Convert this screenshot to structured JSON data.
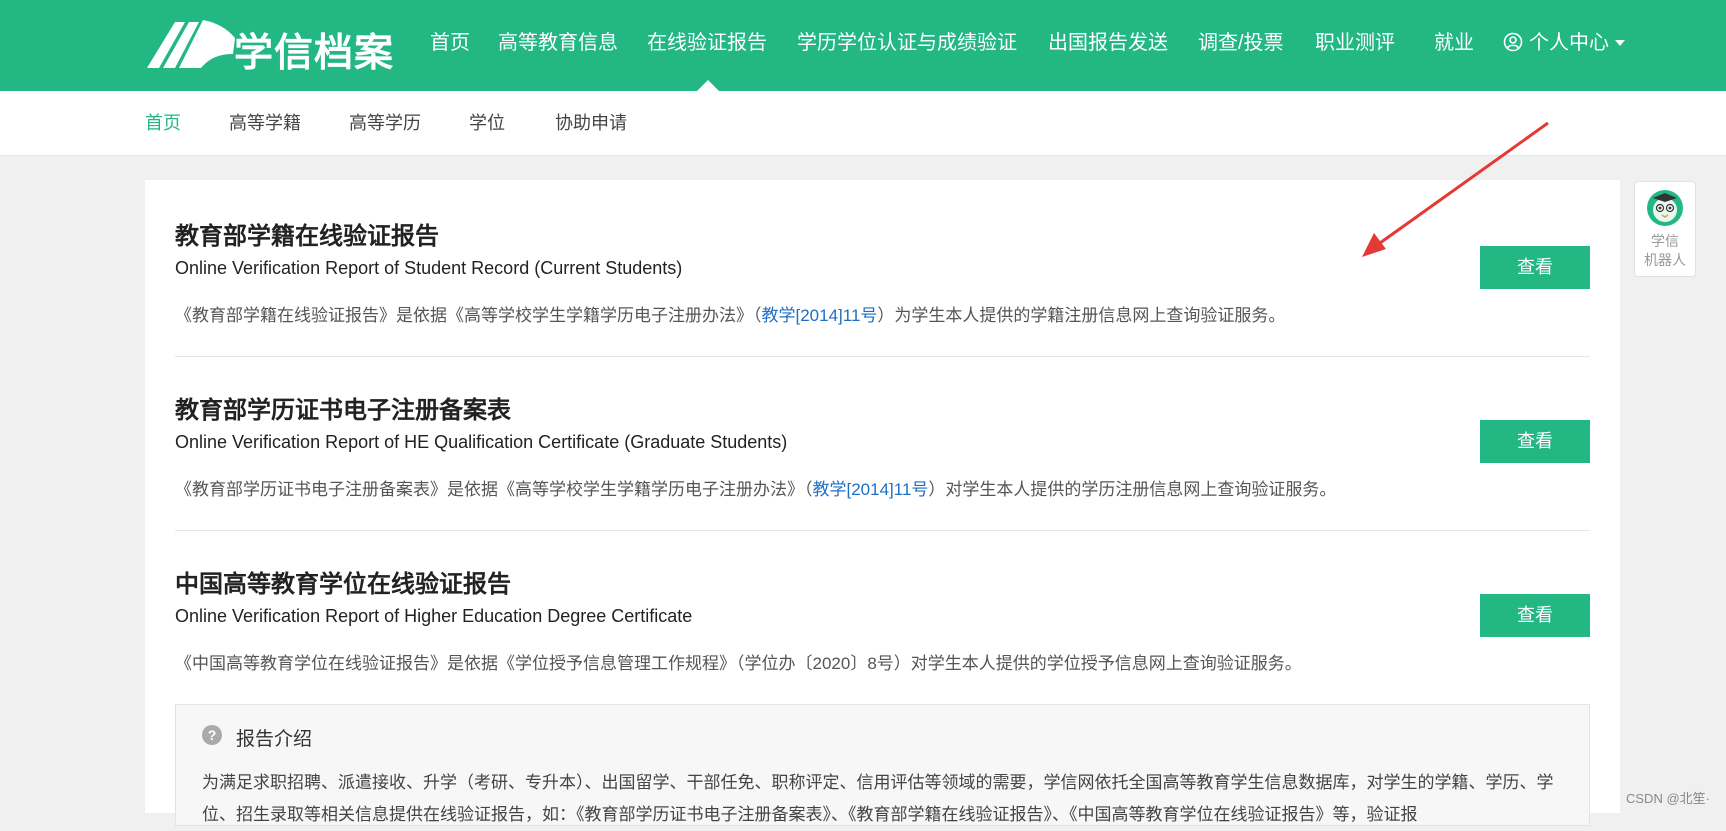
{
  "brand": {
    "name": "学信档案"
  },
  "top_nav": [
    {
      "label": "首页"
    },
    {
      "label": "高等教育信息"
    },
    {
      "label": "在线验证报告"
    },
    {
      "label": "学历学位认证与成绩验证"
    },
    {
      "label": "出国报告发送"
    },
    {
      "label": "调查/投票"
    },
    {
      "label": "职业测评"
    },
    {
      "label": "就业"
    },
    {
      "label": "个人中心"
    }
  ],
  "sub_nav": [
    {
      "label": "首页"
    },
    {
      "label": "高等学籍"
    },
    {
      "label": "高等学历"
    },
    {
      "label": "学位"
    },
    {
      "label": "协助申请"
    }
  ],
  "reports": [
    {
      "title": "教育部学籍在线验证报告",
      "subtitle": "Online Verification Report of Student Record (Current Students)",
      "desc_before": "《教育部学籍在线验证报告》是依据《高等学校学生学籍学历电子注册办法》（",
      "desc_link": "教学[2014]11号",
      "desc_after": "）为学生本人提供的学籍注册信息网上查询验证服务。",
      "button": "查看"
    },
    {
      "title": "教育部学历证书电子注册备案表",
      "subtitle": "Online Verification Report of HE Qualification Certificate (Graduate Students)",
      "desc_before": "《教育部学历证书电子注册备案表》是依据《高等学校学生学籍学历电子注册办法》（",
      "desc_link": "教学[2014]11号",
      "desc_after": "）对学生本人提供的学历注册信息网上查询验证服务。",
      "button": "查看"
    },
    {
      "title": "中国高等教育学位在线验证报告",
      "subtitle": "Online Verification Report of Higher Education Degree Certificate",
      "desc_before": "《中国高等教育学位在线验证报告》是依据《学位授予信息管理工作规程》（学位办〔2020〕8号）对学生本人提供的学位授予信息网上查询验证服务。",
      "desc_link": "",
      "desc_after": "",
      "button": "查看"
    }
  ],
  "intro": {
    "icon": "?",
    "title": "报告介绍",
    "text": "为满足求职招聘、派遣接收、升学（考研、专升本）、出国留学、干部任免、职称评定、信用评估等领域的需要，学信网依托全国高等教育学生信息数据库，对学生的学籍、学历、学位、招生录取等相关信息提供在线验证报告，如：《教育部学历证书电子注册备案表》、《教育部学籍在线验证报告》、《中国高等教育学位在线验证报告》等，验证报"
  },
  "robot": {
    "line1": "学信",
    "line2": "机器人"
  },
  "watermark": "CSDN @北笙·",
  "colors": {
    "accent": "#22b783",
    "link": "#1f6fc5",
    "annotation": "#e53935"
  }
}
